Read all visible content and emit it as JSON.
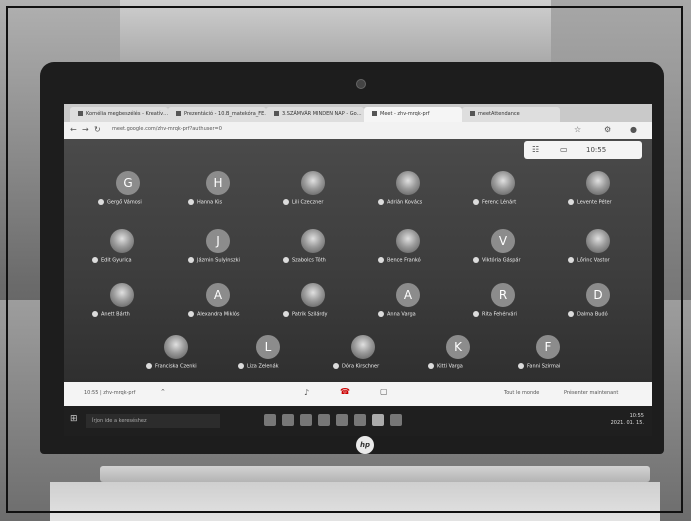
{
  "browser": {
    "tabs": [
      {
        "label": "Kornélia megbeszélés - Kreatív…",
        "active": false
      },
      {
        "label": "Prezentáció - 10.B_matekóra_FE…",
        "active": false
      },
      {
        "label": "3.SZÁMVÁR MINDEN NAP - Go…",
        "active": false
      },
      {
        "label": "Meet - zhv-mrqk-prf",
        "active": true
      },
      {
        "label": "meetAttendance",
        "active": false
      }
    ],
    "url": "meet.google.com/zhv-mrqk-prf?authuser=0"
  },
  "meet": {
    "top_counter": "10:55",
    "participants": [
      {
        "initial": "G",
        "name": "Gergő Vámosi",
        "photo": false
      },
      {
        "initial": "H",
        "name": "Hanna Kis",
        "photo": false
      },
      {
        "initial": "",
        "name": "Lili Czeczner",
        "photo": true
      },
      {
        "initial": "",
        "name": "Adrián Kovács",
        "photo": true
      },
      {
        "initial": "",
        "name": "Ferenc Lénárt",
        "photo": true
      },
      {
        "initial": "",
        "name": "Levente Péter",
        "photo": true
      },
      {
        "initial": "",
        "name": "Edit Gyurica",
        "photo": true
      },
      {
        "initial": "J",
        "name": "Jázmin Sulyinszki",
        "photo": false
      },
      {
        "initial": "",
        "name": "Szabolcs Tóth",
        "photo": true
      },
      {
        "initial": "",
        "name": "Bence Frankó",
        "photo": true
      },
      {
        "initial": "V",
        "name": "Viktória Gáspár",
        "photo": false
      },
      {
        "initial": "",
        "name": "Lőrinc Vastor",
        "photo": true
      },
      {
        "initial": "",
        "name": "Anett Bárth",
        "photo": true
      },
      {
        "initial": "A",
        "name": "Alexandra Miklós",
        "photo": false
      },
      {
        "initial": "",
        "name": "Patrik Szilárdy",
        "photo": true
      },
      {
        "initial": "A",
        "name": "Anna Varga",
        "photo": false
      },
      {
        "initial": "R",
        "name": "Rita Fehérvári",
        "photo": false
      },
      {
        "initial": "D",
        "name": "Dalma Budó",
        "photo": false
      },
      {
        "initial": "",
        "name": "Franciska Czenki",
        "photo": true
      },
      {
        "initial": "L",
        "name": "Liza Zelenák",
        "photo": false
      },
      {
        "initial": "",
        "name": "Dóra Kirschner",
        "photo": true
      },
      {
        "initial": "K",
        "name": "Kitti Varga",
        "photo": false
      },
      {
        "initial": "F",
        "name": "Fanni Szirmai",
        "photo": false
      }
    ],
    "bottom_left": "10:55 | zhv-mrqk-prf",
    "bottom_right_1": "Tout le monde",
    "bottom_right_2": "Présenter maintenant"
  },
  "taskbar": {
    "search_placeholder": "Írjon ide a kereséshez",
    "clock_time": "10:55",
    "clock_date": "2021. 01. 15."
  },
  "laptop": {
    "logo": "hp"
  }
}
